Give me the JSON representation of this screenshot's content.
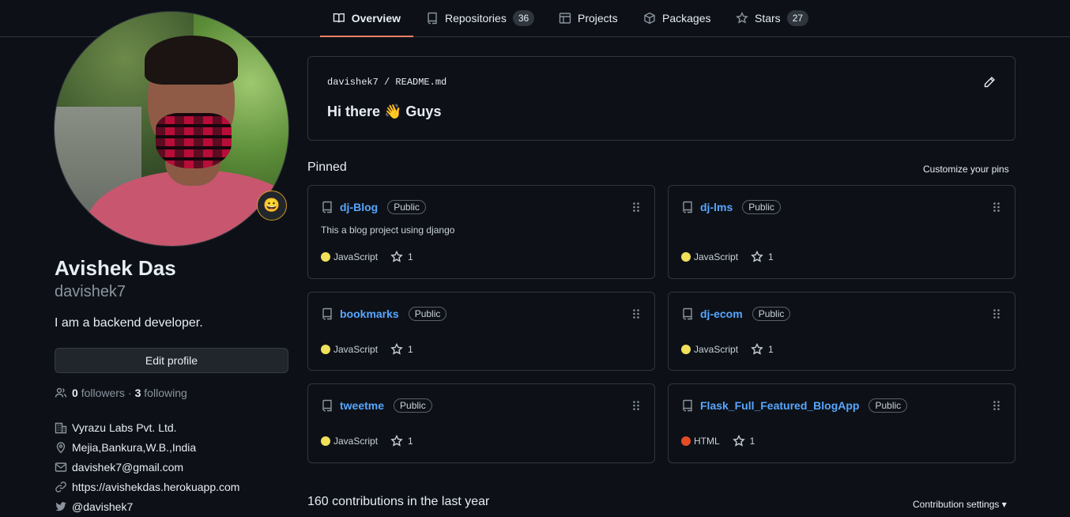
{
  "tabs": [
    {
      "label": "Overview",
      "icon": "book-icon",
      "count": null
    },
    {
      "label": "Repositories",
      "icon": "repo-icon",
      "count": "36"
    },
    {
      "label": "Projects",
      "icon": "table-icon",
      "count": null
    },
    {
      "label": "Packages",
      "icon": "package-icon",
      "count": null
    },
    {
      "label": "Stars",
      "icon": "star-icon",
      "count": "27"
    }
  ],
  "profile": {
    "status_emoji": "😀",
    "full_name": "Avishek Das",
    "username": "davishek7",
    "bio": "I am a backend developer.",
    "edit_label": "Edit profile",
    "followers_count": "0",
    "followers_label": "followers",
    "separator": "·",
    "following_count": "3",
    "following_label": "following",
    "details": [
      {
        "icon": "organization-icon",
        "text": "Vyrazu Labs Pvt. Ltd."
      },
      {
        "icon": "location-icon",
        "text": "Mejia,Bankura,W.B.,India"
      },
      {
        "icon": "mail-icon",
        "text": "davishek7@gmail.com"
      },
      {
        "icon": "link-icon",
        "text": "https://avishekdas.herokuapp.com"
      },
      {
        "icon": "twitter-icon",
        "text": "@davishek7"
      }
    ]
  },
  "readme": {
    "owner": "davishek7",
    "slash": "/",
    "file": "README.md",
    "heading": "Hi there 👋 Guys"
  },
  "pinned": {
    "title": "Pinned",
    "customize_label": "Customize your pins",
    "repos": [
      {
        "name": "dj-Blog",
        "visibility": "Public",
        "description": "This a blog project using django",
        "language": "JavaScript",
        "lang_color": "#f1e05a",
        "stars": "1"
      },
      {
        "name": "dj-lms",
        "visibility": "Public",
        "description": "",
        "language": "JavaScript",
        "lang_color": "#f1e05a",
        "stars": "1"
      },
      {
        "name": "bookmarks",
        "visibility": "Public",
        "description": "",
        "language": "JavaScript",
        "lang_color": "#f1e05a",
        "stars": "1"
      },
      {
        "name": "dj-ecom",
        "visibility": "Public",
        "description": "",
        "language": "JavaScript",
        "lang_color": "#f1e05a",
        "stars": "1"
      },
      {
        "name": "tweetme",
        "visibility": "Public",
        "description": "",
        "language": "JavaScript",
        "lang_color": "#f1e05a",
        "stars": "1"
      },
      {
        "name": "Flask_Full_Featured_BlogApp",
        "visibility": "Public",
        "description": "",
        "language": "HTML",
        "lang_color": "#e34c26",
        "stars": "1"
      }
    ]
  },
  "contributions": {
    "summary": "160 contributions in the last year",
    "settings_label": "Contribution settings ▾"
  }
}
